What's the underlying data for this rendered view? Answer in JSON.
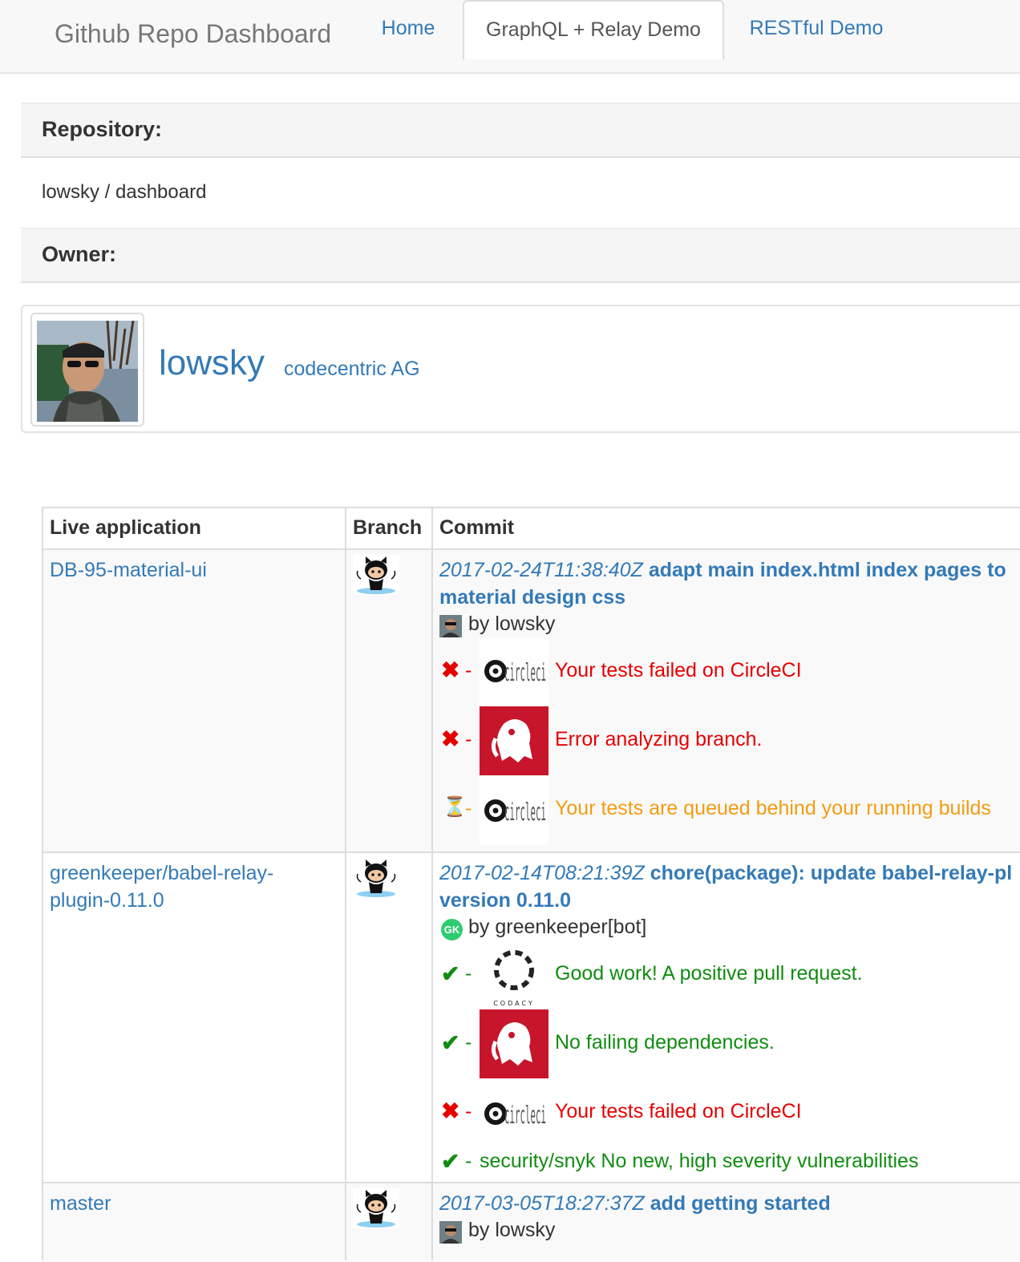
{
  "navbar": {
    "brand": "Github Repo Dashboard",
    "tabs": [
      {
        "label": "Home",
        "active": false
      },
      {
        "label": "GraphQL + Relay Demo",
        "active": true
      },
      {
        "label": "RESTful Demo",
        "active": false
      }
    ]
  },
  "repository": {
    "heading": "Repository:",
    "name": "lowsky / dashboard"
  },
  "owner": {
    "heading": "Owner:",
    "login": "lowsky",
    "company": "codecentric AG"
  },
  "table": {
    "headers": [
      "Live application",
      "Branch",
      "Commit"
    ],
    "rows": [
      {
        "branch": "DB-95-material-ui",
        "commit_date": "2017-02-24T11:38:40Z",
        "commit_message_line1": "adapt main index.html index pages to",
        "commit_message_line2": "material design css",
        "author": "by lowsky",
        "statuses": [
          {
            "icon": "✖",
            "dash": "-",
            "service": "circleci-logo",
            "text": "Your tests failed on CircleCI",
            "state": "failure"
          },
          {
            "icon": "✖",
            "dash": "-",
            "service": "snyk-dog-logo",
            "text": "Error analyzing branch.",
            "state": "failure"
          },
          {
            "icon": "⏳",
            "dash": "-",
            "service": "circleci-logo",
            "text": "Your tests are queued behind your running builds",
            "state": "pending"
          }
        ]
      },
      {
        "branch": "greenkeeper/babel-relay-plugin-0.11.0",
        "branch_line1": "greenkeeper/babel-relay-",
        "branch_line2": "plugin-0.11.0",
        "commit_date": "2017-02-14T08:21:39Z",
        "commit_message_line1": "chore(package): update babel-relay-pl",
        "commit_message_line2": "version 0.11.0",
        "author": "by greenkeeper[bot]",
        "author_badge": "GK",
        "statuses": [
          {
            "icon": "✔",
            "dash": "-",
            "service": "codacy-logo",
            "service_label": "CODACY",
            "text": "Good work! A positive pull request.",
            "state": "success"
          },
          {
            "icon": "✔",
            "dash": "-",
            "service": "snyk-dog-logo",
            "text": "No failing dependencies.",
            "state": "success"
          },
          {
            "icon": "✖",
            "dash": "-",
            "service": "circleci-logo",
            "text": "Your tests failed on CircleCI",
            "state": "failure"
          },
          {
            "icon": "✔",
            "dash": "-",
            "service": "none",
            "text": "security/snyk No new, high severity vulnerabilities",
            "state": "success"
          }
        ]
      },
      {
        "branch": "master",
        "commit_date": "2017-03-05T18:27:37Z",
        "commit_message_line1": "add getting started",
        "author": "by lowsky"
      }
    ]
  },
  "colors": {
    "link": "#337ab7",
    "failure": "#e50000",
    "success": "#118c11",
    "pending": "#f39c12",
    "snyk_red": "#c7162b"
  }
}
